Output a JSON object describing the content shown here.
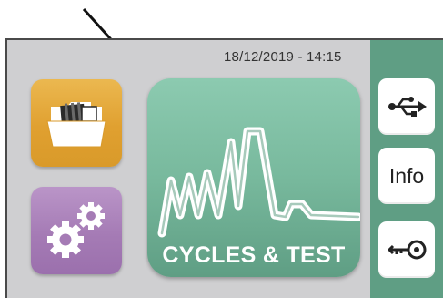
{
  "status_bar": {
    "datetime": "18/12/2019 - 14:15"
  },
  "main": {
    "files_button": {
      "icon": "folder-icon"
    },
    "settings_button": {
      "icon": "gears-icon"
    },
    "cycles_button": {
      "label": "CYCLES & TEST",
      "icon": "waveform-icon"
    }
  },
  "sidebar": {
    "usb": {
      "icon": "usb-icon"
    },
    "info": {
      "label": "Info"
    },
    "key": {
      "icon": "key-icon"
    }
  },
  "colors": {
    "accent_green": "#5f9e84",
    "files_orange": "#e0a030",
    "settings_purple": "#a57bb5",
    "screen_gray": "#cfcfd1"
  }
}
